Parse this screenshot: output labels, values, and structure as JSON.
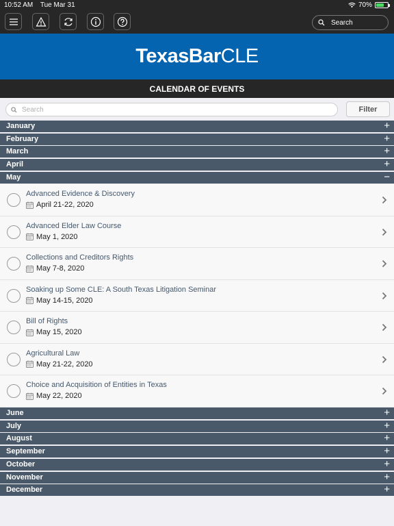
{
  "status_bar": {
    "time": "10:52 AM",
    "date": "Tue Mar 31",
    "battery": "70%",
    "battery_level": 0.7
  },
  "toolbar": {
    "search_label": "Search"
  },
  "banner": {
    "logo_bold": "TexasBar",
    "logo_light": "CLE"
  },
  "page": {
    "title": "CALENDAR OF EVENTS"
  },
  "search": {
    "placeholder": "Search",
    "filter_label": "Filter"
  },
  "months_top": [
    {
      "label": "January",
      "toggle": "+"
    },
    {
      "label": "February",
      "toggle": "+"
    },
    {
      "label": "March",
      "toggle": "+"
    },
    {
      "label": "April",
      "toggle": "+"
    },
    {
      "label": "May",
      "toggle": "−"
    }
  ],
  "events": [
    {
      "title": "Advanced Evidence & Discovery",
      "date": "April 21-22, 2020"
    },
    {
      "title": "Advanced Elder Law Course",
      "date": "May 1, 2020"
    },
    {
      "title": "Collections and Creditors Rights",
      "date": "May 7-8, 2020"
    },
    {
      "title": "Soaking up Some CLE: A South Texas Litigation Seminar",
      "date": "May 14-15, 2020"
    },
    {
      "title": "Bill of Rights",
      "date": "May 15, 2020"
    },
    {
      "title": "Agricultural Law",
      "date": "May 21-22, 2020"
    },
    {
      "title": "Choice and Acquisition of Entities in Texas",
      "date": "May 22, 2020"
    }
  ],
  "months_bottom": [
    {
      "label": "June",
      "toggle": "+"
    },
    {
      "label": "July",
      "toggle": "+"
    },
    {
      "label": "August",
      "toggle": "+"
    },
    {
      "label": "September",
      "toggle": "+"
    },
    {
      "label": "October",
      "toggle": "+"
    },
    {
      "label": "November",
      "toggle": "+"
    },
    {
      "label": "December",
      "toggle": "+"
    }
  ],
  "colors": {
    "banner": "#0564b0",
    "month_bar": "#4a5969",
    "toolbar": "#272727",
    "title_bar": "#262626"
  }
}
